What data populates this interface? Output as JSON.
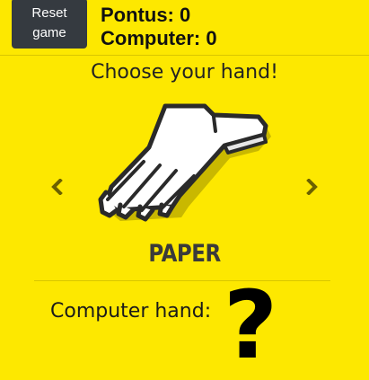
{
  "header": {
    "reset_label": "Reset game",
    "player_score": "Pontus: 0",
    "computer_score": "Computer: 0"
  },
  "main": {
    "prompt": "Choose your hand!",
    "selected_hand": {
      "label": "PAPER",
      "icon": "paper-hand-icon"
    },
    "prev_icon": "chevron-left-icon",
    "next_icon": "chevron-right-icon"
  },
  "computer": {
    "label": "Computer hand:",
    "hand": "?"
  },
  "colors": {
    "background": "#fde800",
    "button": "#353a40",
    "arrow": "#6b6100"
  }
}
